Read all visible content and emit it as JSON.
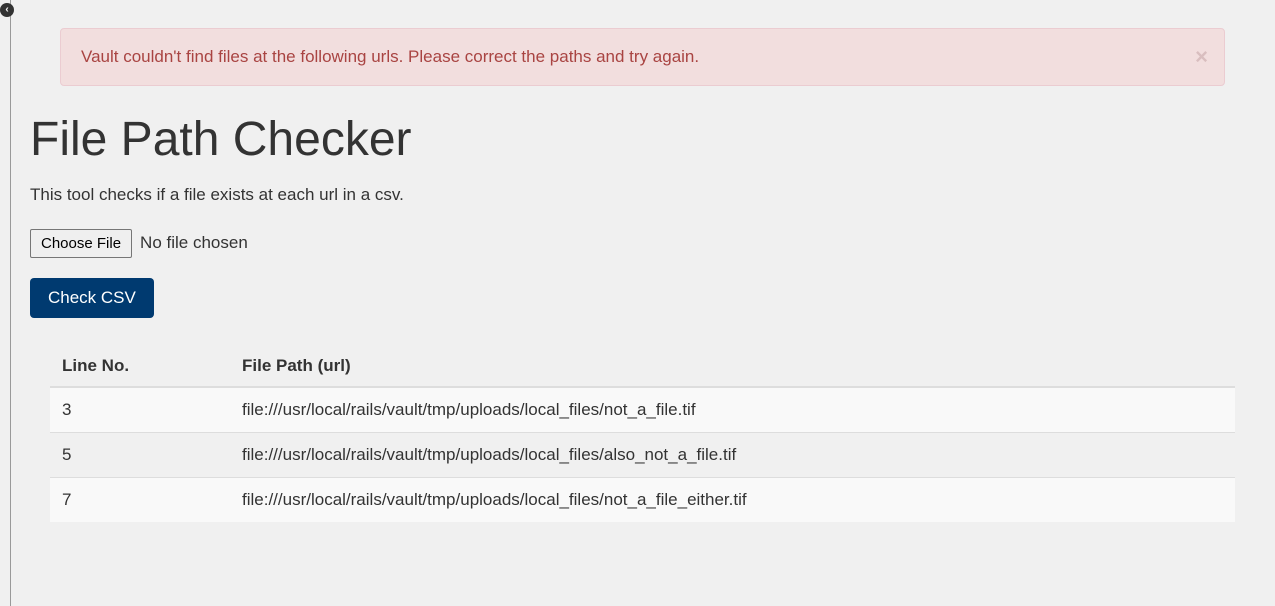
{
  "corner_badge": "‹",
  "alert": {
    "message": "Vault couldn't find files at the following urls. Please correct the paths and try again.",
    "close_label": "×"
  },
  "page_title": "File Path Checker",
  "description": "This tool checks if a file exists at each url in a csv.",
  "file_input": {
    "button_label": "Choose File",
    "status": "No file chosen"
  },
  "submit_button_label": "Check CSV",
  "results_table": {
    "headers": {
      "line_no": "Line No.",
      "file_path": "File Path (url)"
    },
    "rows": [
      {
        "line_no": "3",
        "file_path": "file:///usr/local/rails/vault/tmp/uploads/local_files/not_a_file.tif"
      },
      {
        "line_no": "5",
        "file_path": "file:///usr/local/rails/vault/tmp/uploads/local_files/also_not_a_file.tif"
      },
      {
        "line_no": "7",
        "file_path": "file:///usr/local/rails/vault/tmp/uploads/local_files/not_a_file_either.tif"
      }
    ]
  }
}
